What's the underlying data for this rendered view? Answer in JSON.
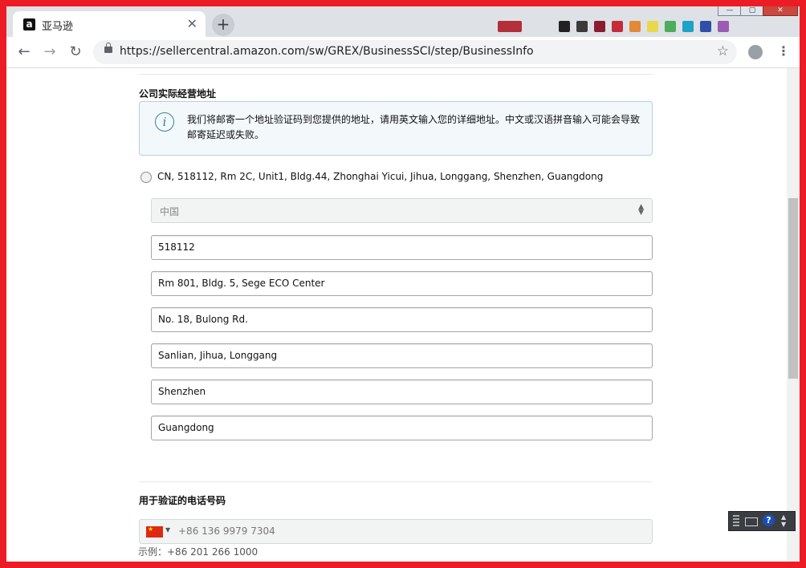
{
  "browser": {
    "tab_title": "亚马逊",
    "tab_favicon": "a",
    "url": "https://sellercentral.amazon.com/sw/GREX/BusinessSCI/step/BusinessInfo",
    "icons": [
      "back-icon",
      "forward-icon",
      "reload-icon",
      "lock-icon",
      "star-icon",
      "profile-icon",
      "menu-icon",
      "close-icon",
      "plus-icon"
    ]
  },
  "address_section": {
    "title": "公司实际经营地址",
    "notice": "我们将邮寄一个地址验证码到您提供的地址，请用英文输入您的详细地址。中文或汉语拼音输入可能会导致邮寄延迟或失败。",
    "saved_address": "CN, 518112, Rm 2C, Unit1, Bldg.44, Zhonghai Yicui, Jihua, Longgang, Shenzhen, Guangdong",
    "country": "中国",
    "fields": {
      "postal_code": "518112",
      "address_line1": "Rm 801, Bldg. 5, Sege ECO Center",
      "address_line2": "No. 18, Bulong Rd.",
      "district": "Sanlian, Jihua, Longgang",
      "city": "Shenzhen",
      "province": "Guangdong"
    }
  },
  "phone_section": {
    "title": "用于验证的电话号码",
    "value": "+86 136 9979 7304",
    "example": "示例：+86 201 266 1000"
  },
  "colors": {
    "frame": "#ec1c24",
    "notice_bg": "#f3f8fb",
    "notice_border": "#b8d0dc",
    "info_icon": "#3b7fa7"
  }
}
